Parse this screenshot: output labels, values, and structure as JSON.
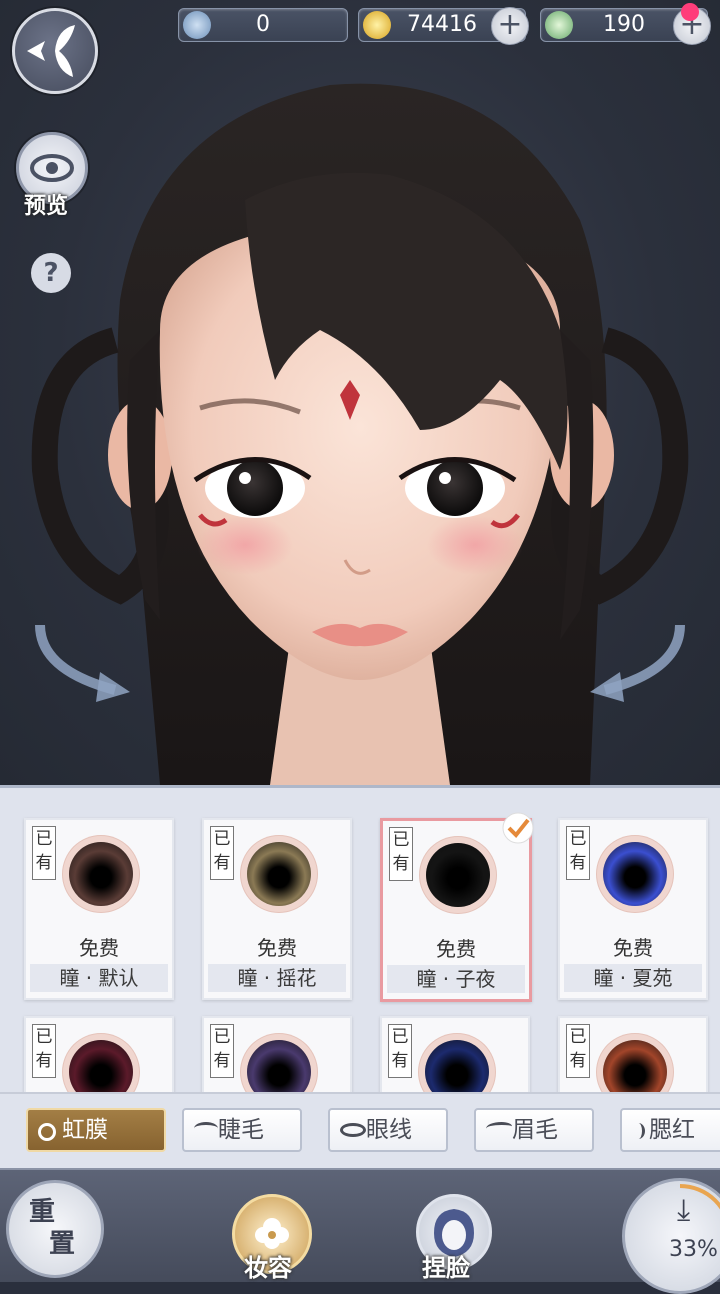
{
  "currency": {
    "jade": {
      "value": "0",
      "icon": "jade-coin-icon"
    },
    "copper": {
      "value": "74416",
      "icon": "copper-coin-icon"
    },
    "silver": {
      "value": "190",
      "icon": "silver-coin-icon"
    }
  },
  "left_tools": {
    "back_icon": "butterfly-back-icon",
    "preview_label": "预览",
    "help_label": "?"
  },
  "iris_options": [
    {
      "owned": "已有",
      "price": "免费",
      "name": "瞳 · 默认",
      "color": "#5a3c36",
      "selected": false
    },
    {
      "owned": "已有",
      "price": "免费",
      "name": "瞳 · 摇花",
      "color": "#8b7a55",
      "selected": false
    },
    {
      "owned": "已有",
      "price": "免费",
      "name": "瞳 · 子夜",
      "color": "#141414",
      "selected": true
    },
    {
      "owned": "已有",
      "price": "免费",
      "name": "瞳 · 夏苑",
      "color": "#3b4fd0",
      "selected": false
    },
    {
      "owned": "已有",
      "color": "#5b1a2a"
    },
    {
      "owned": "已有",
      "color": "#4a3a6e"
    },
    {
      "owned": "已有",
      "color": "#1c2a6e"
    },
    {
      "owned": "已有",
      "color": "#a2452a"
    }
  ],
  "tabs": [
    {
      "label": "虹膜",
      "icon": "iris-icon",
      "active": true
    },
    {
      "label": "睫毛",
      "icon": "eyelash-icon",
      "active": false
    },
    {
      "label": "眼线",
      "icon": "eye-icon",
      "active": false
    },
    {
      "label": "眉毛",
      "icon": "eyebrow-icon",
      "active": false
    },
    {
      "label": "腮红",
      "icon": "blush-icon",
      "active": false
    }
  ],
  "bottom": {
    "reset_label_1": "重",
    "reset_label_2": "置",
    "makeup_label": "妆容",
    "face_label": "捏脸",
    "download_progress": "33%"
  },
  "colors": {
    "active_tab": "#957040",
    "selected_border": "#e99aa0",
    "check": "#e58a3a"
  }
}
